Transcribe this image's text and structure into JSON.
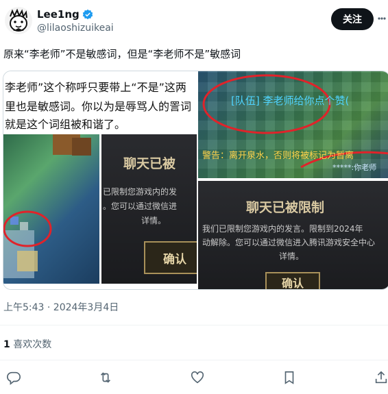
{
  "author": {
    "display_name": "Lee1ng",
    "handle": "@lilaoshizuikeai",
    "verified_icon": "verified-badge-icon",
    "avatar_icon": "cartoon-avatar"
  },
  "header": {
    "follow_label": "关注",
    "more_icon": "more-icon"
  },
  "tweet": {
    "text": "原来“李老师”不是敏感词，但是“李老师不是”敏感词",
    "timestamp": "上午5:43 · 2024年3月4日",
    "likes_count": "1",
    "likes_label": "喜欢次数"
  },
  "media": {
    "left": {
      "text_lines": [
        "李老师”这个称呼只要带上“不是”这两",
        "里也是敏感词。你以为是辱骂人的詈词",
        "就是这个词组被和谐了。"
      ],
      "dialog_title": "聊天已被",
      "dialog_body": [
        "已限制您游戏内的发",
        "。您可以通过微信进",
        "详情。"
      ],
      "button": "确认"
    },
    "top_right": {
      "line1": "[队伍] 李老师给你点个赞(",
      "line2": "警告：离开泉水，否则将被标记为暂离",
      "line3": "*****:你老师"
    },
    "bottom_right": {
      "dialog_title": "聊天已被限制",
      "dialog_body": [
        "我们已限制您游戏内的发言。限制到2024年",
        "动解除。您可以通过微信进入腾讯游戏安全中心",
        "详情。"
      ],
      "button": "确认"
    }
  },
  "actions": {
    "reply_icon": "reply-icon",
    "retweet_icon": "retweet-icon",
    "like_icon": "heart-icon",
    "bookmark_icon": "bookmark-icon",
    "share_icon": "share-icon"
  },
  "colors": {
    "accent_blue": "#1d9bf0",
    "text_primary": "#0f1419",
    "text_secondary": "#536471",
    "follow_bg": "#0f1419",
    "circle_red": "#e0232a"
  }
}
